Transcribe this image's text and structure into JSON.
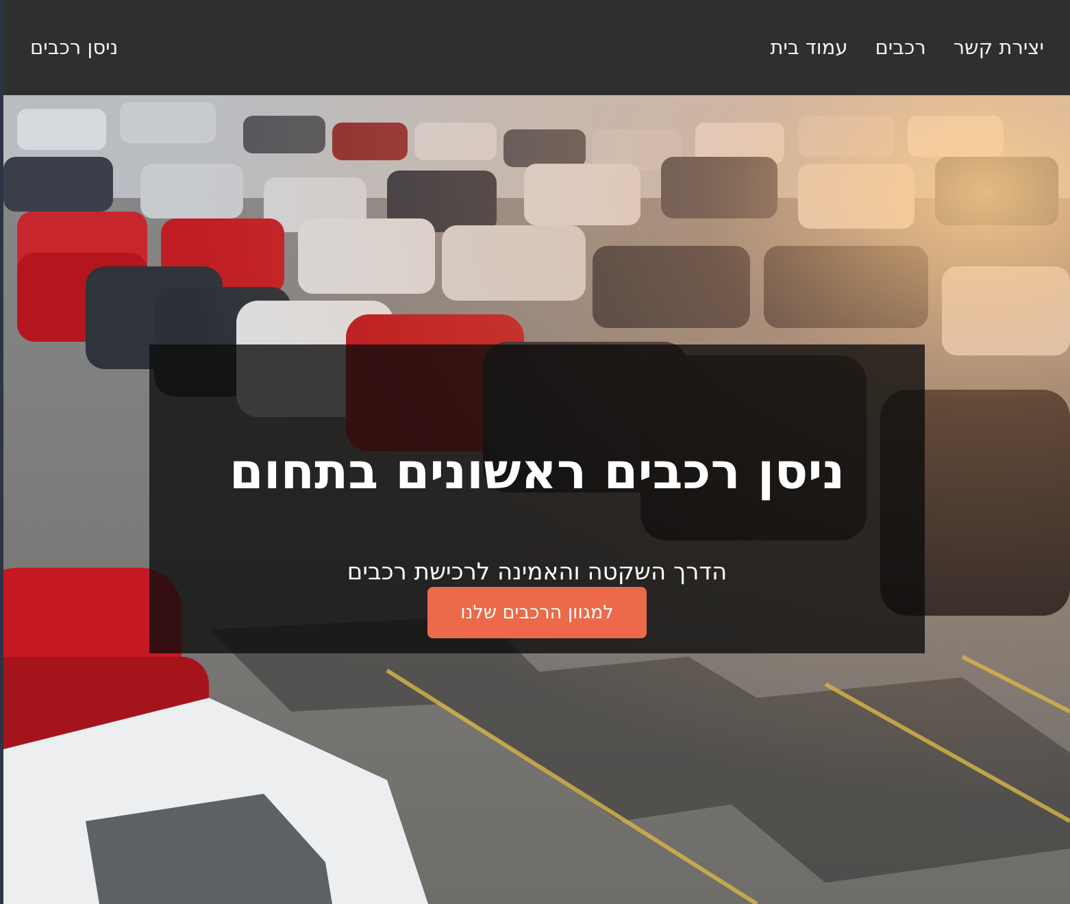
{
  "navbar": {
    "brand": "ניסן רכבים",
    "links": [
      {
        "label": "יצירת קשר"
      },
      {
        "label": "רכבים"
      },
      {
        "label": "עמוד בית"
      }
    ]
  },
  "hero": {
    "background_image": "parking lot full of cars",
    "title": "ניסן רכבים ראשונים בתחום",
    "subtitle": "הדרך השקטה והאמינה לרכישת רכבים",
    "cta_label": "למגוון הרכבים שלנו"
  },
  "colors": {
    "navbar_bg": "#2f2f2f",
    "nav_text": "#f3f3f3",
    "overlay": "rgba(12,12,12,0.78)",
    "cta_bg": "#ec6a49",
    "cta_text": "#ffffff"
  }
}
